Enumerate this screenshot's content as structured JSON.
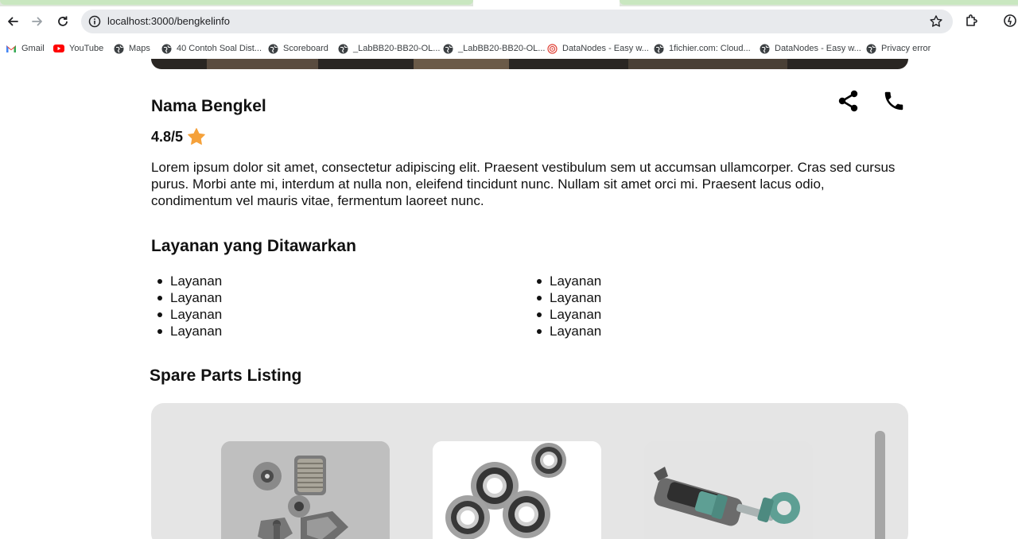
{
  "browser": {
    "url": "localhost:3000/bengkelinfo",
    "bookmarks": [
      {
        "label": "Gmail",
        "icon": "gmail-icon"
      },
      {
        "label": "YouTube",
        "icon": "youtube-icon"
      },
      {
        "label": "Maps",
        "icon": "globe-icon"
      },
      {
        "label": "40 Contoh Soal Dist...",
        "icon": "globe-icon"
      },
      {
        "label": "Scoreboard",
        "icon": "globe-icon"
      },
      {
        "label": "_LabBB20-BB20-OL...",
        "icon": "globe-icon"
      },
      {
        "label": "_LabBB20-BB20-OL...",
        "icon": "globe-icon"
      },
      {
        "label": "DataNodes - Easy w...",
        "icon": "datanodes-icon"
      },
      {
        "label": "1fichier.com: Cloud...",
        "icon": "globe-icon"
      },
      {
        "label": "DataNodes - Easy w...",
        "icon": "globe-icon"
      },
      {
        "label": "Privacy error",
        "icon": "globe-icon"
      }
    ]
  },
  "shop": {
    "name": "Nama Bengkel",
    "rating": "4.8/5",
    "description": "Lorem ipsum dolor sit amet, consectetur adipiscing elit. Praesent vestibulum sem ut accumsan ullamcorper. Cras sed cursus purus. Morbi ante mi, interdum at nulla non, eleifend tincidunt nunc. Nullam sit amet orci mi. Praesent lacus odio, condimentum vel mauris vitae, fermentum laoreet nunc."
  },
  "services": {
    "heading": "Layanan yang Ditawarkan",
    "column1": [
      "Layanan",
      "Layanan",
      "Layanan",
      "Layanan"
    ],
    "column2": [
      "Layanan",
      "Layanan",
      "Layanan",
      "Layanan"
    ]
  },
  "spare_parts": {
    "heading": "Spare Parts Listing",
    "items": [
      {
        "image": "filters-and-brake-pads-image"
      },
      {
        "image": "ball-bearings-image"
      },
      {
        "image": "shock-absorber-image"
      }
    ]
  },
  "colors": {
    "star": "#f5a13a",
    "panel": "#e5e5e5",
    "text": "#111111"
  }
}
